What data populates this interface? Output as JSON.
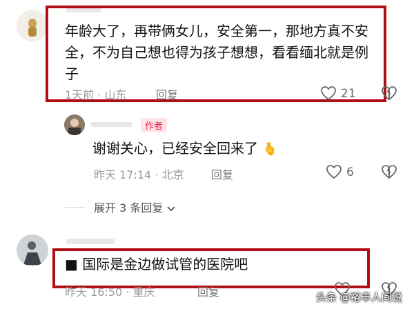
{
  "comments": [
    {
      "text": "年龄大了，再带俩女儿，安全第一，那地方真不安全，不为自己想也得为孩子想想，看看缅北就是例子",
      "meta": "1天前 · 山东",
      "reply_label": "回复",
      "like_count": "21"
    },
    {
      "author_badge": "作者",
      "text": "谢谢关心，已经安全回来了",
      "emoji": "🫰",
      "meta": "昨天 17:14 · 北京",
      "reply_label": "回复",
      "like_count": "6"
    },
    {
      "text": "■ 国际是金边做试管的医院吧",
      "meta": "昨天 16:50 · 重庆",
      "reply_label": "回复"
    }
  ],
  "expand_replies": "展开 3 条回复",
  "watermark": "头条 @裕丰人间说",
  "colors": {
    "highlight_border": "#b10f12",
    "badge_text": "#e0244a",
    "badge_bg": "#ffe5e8"
  }
}
